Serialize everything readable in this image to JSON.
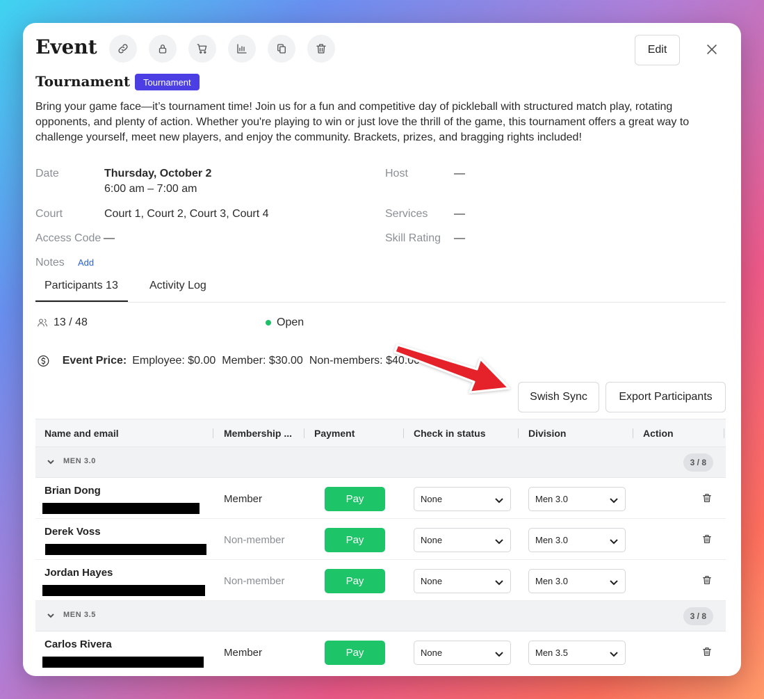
{
  "header": {
    "title": "Event",
    "edit_label": "Edit",
    "toolbar_icons": [
      "link-icon",
      "lock-icon",
      "cart-icon",
      "chart-icon",
      "copy-icon",
      "trash-icon"
    ]
  },
  "event": {
    "name": "Tournament",
    "badge": "Tournament",
    "description": "Bring your game face—it’s tournament time! Join us for a fun and competitive day of pickleball with structured match play, rotating opponents, and plenty of action. Whether you're playing to win or just love the thrill of the game, this tournament offers a great way to challenge yourself, meet new players, and enjoy the community. Brackets, prizes, and bragging rights included!"
  },
  "details": {
    "date_label": "Date",
    "date_value": "Thursday, October 2",
    "time_value": "6:00 am – 7:00 am",
    "host_label": "Host",
    "host_value": "—",
    "court_label": "Court",
    "court_value": "Court 1, Court 2, Court 3, Court 4",
    "services_label": "Services",
    "services_value": "—",
    "access_label": "Access Code",
    "access_value": "—",
    "skill_label": "Skill Rating",
    "skill_value": "—",
    "notes_label": "Notes",
    "notes_add": "Add"
  },
  "tabs": {
    "participants": "Participants 13",
    "activity": "Activity Log"
  },
  "summary": {
    "capacity": "13 / 48",
    "status": "Open",
    "status_color": "#1fbf6a",
    "price_label": "Event Price:",
    "price_employee": "Employee: $0.00",
    "price_member": "Member: $30.00",
    "price_nonmember": "Non-members: $40.00"
  },
  "actions": {
    "swish_sync": "Swish Sync",
    "export": "Export Participants"
  },
  "table": {
    "columns": [
      "Name and email",
      "Membership ...",
      "Payment",
      "Check in status",
      "Division",
      "Action"
    ],
    "groups": [
      {
        "name": "MEN 3.0",
        "count": "3 / 8",
        "rows": [
          {
            "name": "Brian Dong",
            "membership": "Member",
            "pay": "Pay",
            "checkin": "None",
            "division": "Men 3.0"
          },
          {
            "name": "Derek Voss",
            "membership": "Non-member",
            "pay": "Pay",
            "checkin": "None",
            "division": "Men 3.0"
          },
          {
            "name": "Jordan Hayes",
            "membership": "Non-member",
            "pay": "Pay",
            "checkin": "None",
            "division": "Men 3.0"
          }
        ]
      },
      {
        "name": "MEN 3.5",
        "count": "3 / 8",
        "rows": [
          {
            "name": "Carlos Rivera",
            "membership": "Member",
            "pay": "Pay",
            "checkin": "None",
            "division": "Men 3.5"
          }
        ]
      }
    ]
  },
  "colors": {
    "badge": "#4b3fe3",
    "pay_button": "#1dc468",
    "link": "#2b62d9",
    "annotation_arrow": "#e5242b"
  }
}
